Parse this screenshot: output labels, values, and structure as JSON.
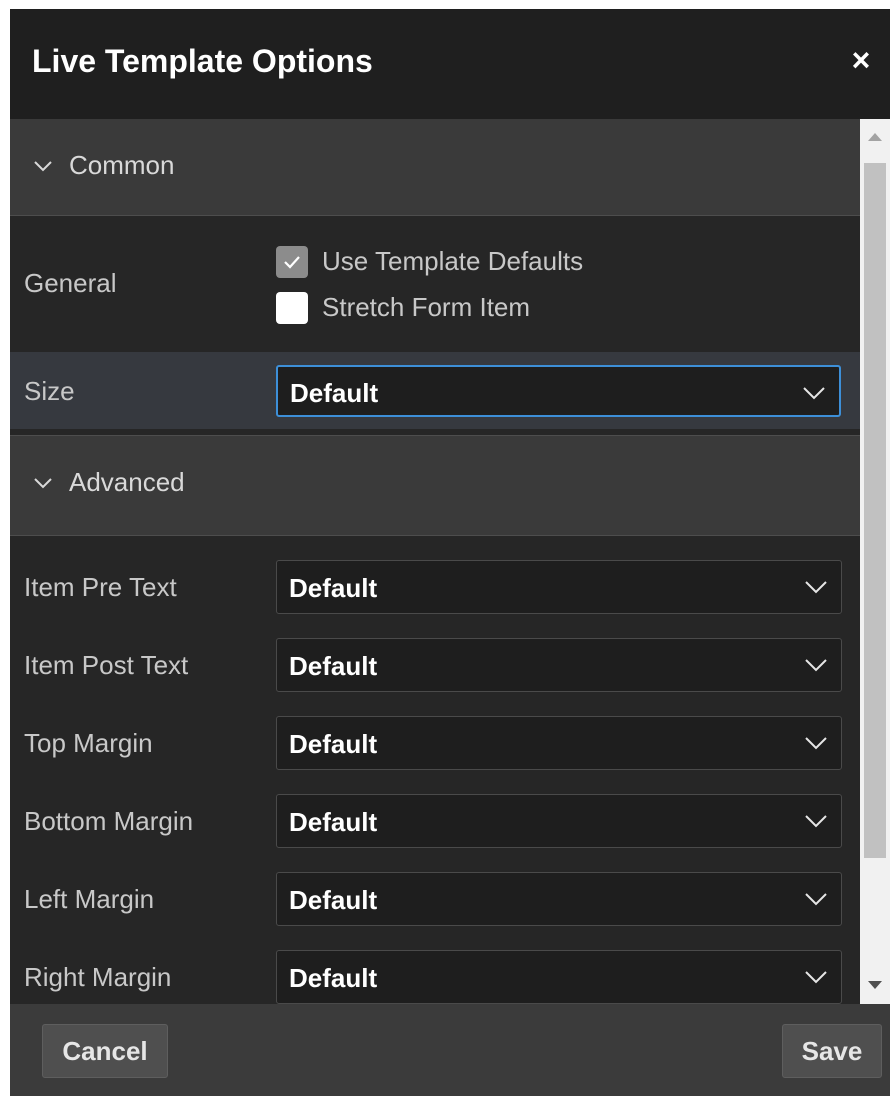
{
  "dialog": {
    "title": "Live Template Options",
    "close_label": "×"
  },
  "sections": {
    "common": {
      "label": "Common"
    },
    "advanced": {
      "label": "Advanced"
    }
  },
  "general": {
    "label": "General",
    "use_template_defaults": {
      "label": "Use Template Defaults",
      "checked": true
    },
    "stretch_form_item": {
      "label": "Stretch Form Item",
      "checked": false
    }
  },
  "size": {
    "label": "Size",
    "value": "Default"
  },
  "advanced_rows": {
    "item_pre_text": {
      "label": "Item Pre Text",
      "value": "Default"
    },
    "item_post_text": {
      "label": "Item Post Text",
      "value": "Default"
    },
    "top_margin": {
      "label": "Top Margin",
      "value": "Default"
    },
    "bottom_margin": {
      "label": "Bottom Margin",
      "value": "Default"
    },
    "left_margin": {
      "label": "Left Margin",
      "value": "Default"
    },
    "right_margin": {
      "label": "Right Margin",
      "value": "Default"
    }
  },
  "footer": {
    "cancel_label": "Cancel",
    "save_label": "Save"
  },
  "icons": {
    "section_chevron": "chevron-down-icon",
    "select_caret": "chevron-down-icon",
    "checkmark": "checkmark-icon",
    "close": "close-icon"
  },
  "colors": {
    "dialog_bg": "#262626",
    "titlebar_bg": "#1f1f1f",
    "section_header_bg": "#3a3a3a",
    "focus_border": "#3d8fd8",
    "footer_bg": "#3b3b3b"
  }
}
